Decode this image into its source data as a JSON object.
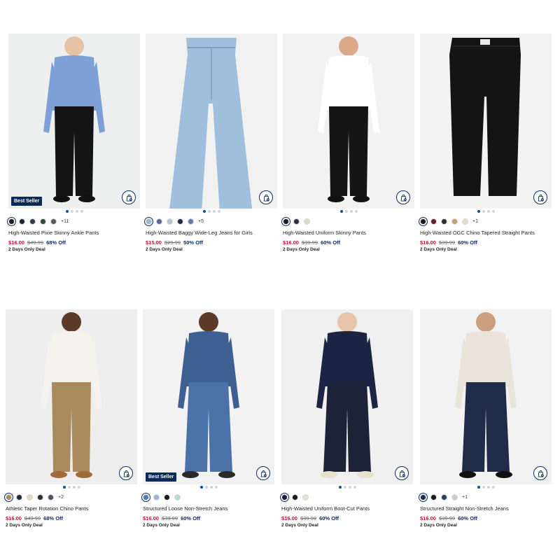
{
  "products": [
    {
      "name": "High-Waisted Pixie Skinny Ankle Pants",
      "sale_price": "$16.00",
      "original_price": "$49.99",
      "discount": "68% Off",
      "deal": "2 Days Only Deal",
      "badge": "Best Seller",
      "swatches": [
        "#1c1c1c",
        "#1f2433",
        "#30394f",
        "#2f4a3a",
        "#5a5a52"
      ],
      "more_colors": "+11",
      "colors": {
        "bg": "#eef0ef",
        "top": "#7ea0d6",
        "pants": "#141414",
        "shoe": "#111111",
        "skin": "#e6c3a6"
      }
    },
    {
      "name": "High-Waisted Baggy Wide-Leg Jeans for Girls",
      "sale_price": "$15.00",
      "original_price": "$29.99",
      "discount": "50% Off",
      "deal": "2 Days Only Deal",
      "badge": "",
      "swatches": [
        "#9ab4d4",
        "#516a97",
        "#b3c4dc",
        "#1f2b45",
        "#5f7ba8"
      ],
      "more_colors": "+5",
      "colors": {
        "bg": "#f1f1f1",
        "pants": "#9fbfdc"
      }
    },
    {
      "name": "High-Waisted Uniform Skinny Pants",
      "sale_price": "$16.00",
      "original_price": "$39.99",
      "discount": "60% Off",
      "deal": "2 Days Only Deal",
      "badge": "",
      "swatches": [
        "#1a1a1a",
        "#2b3140",
        "#e3d9c6"
      ],
      "more_colors": "",
      "colors": {
        "bg": "#f2f2f2",
        "top": "#ffffff",
        "pants": "#151515",
        "shoe": "#111111",
        "skin": "#d9a98a"
      }
    },
    {
      "name": "High-Waisted OGC Chino Tapered Straight Pants",
      "sale_price": "$16.00",
      "original_price": "$39.99",
      "discount": "60% Off",
      "deal": "2 Days Only Deal",
      "badge": "",
      "swatches": [
        "#1a1a1a",
        "#6b1f24",
        "#2b2f3a",
        "#c2a26e",
        "#e7dcc4"
      ],
      "more_colors": "+1",
      "colors": {
        "bg": "#f3f3f3",
        "pants": "#141414"
      }
    },
    {
      "name": "Athletic Taper Rotation Chino Pants",
      "sale_price": "$16.00",
      "original_price": "$49.99",
      "discount": "68% Off",
      "deal": "2 Days Only Deal",
      "badge": "",
      "swatches": [
        "#a88d5f",
        "#1f2a44",
        "#e3d8c1",
        "#2b2e33",
        "#4c5460"
      ],
      "more_colors": "+2",
      "colors": {
        "bg": "#eeeeee",
        "top": "#f4f2ec",
        "pants": "#a88a5c",
        "shoe": "#a06a3b",
        "skin": "#5b3a27"
      }
    },
    {
      "name": "Structured Loose Non-Stretch Jeans",
      "sale_price": "$16.00",
      "original_price": "$39.99",
      "discount": "60% Off",
      "deal": "2 Days Only Deal",
      "badge": "Best Seller",
      "swatches": [
        "#4f79b3",
        "#9fb6d3",
        "#1a1a1a",
        "#b9d8cf"
      ],
      "more_colors": "",
      "colors": {
        "bg": "#f2f2f2",
        "top": "#3e5f91",
        "pants": "#4a72a8",
        "shoe": "#2a2a2a",
        "skin": "#5b3a27"
      }
    },
    {
      "name": "High-Waisted Uniform Boot-Cut Pants",
      "sale_price": "$16.00",
      "original_price": "$39.99",
      "discount": "60% Off",
      "deal": "2 Days Only Deal",
      "badge": "",
      "swatches": [
        "#1c2236",
        "#1a1a1a",
        "#e6e1d5"
      ],
      "more_colors": "",
      "colors": {
        "bg": "#f0f0f0",
        "top": "#1b2442",
        "pants": "#1c2336",
        "shoe": "#e9e1cf",
        "skin": "#e7c4aa"
      }
    },
    {
      "name": "Structured Straight Non-Stretch Jeans",
      "sale_price": "$16.00",
      "original_price": "$39.99",
      "discount": "60% Off",
      "deal": "2 Days Only Deal",
      "badge": "",
      "swatches": [
        "#1f2d4d",
        "#1a1a1a",
        "#2c3f63",
        "#c9cdd2"
      ],
      "more_colors": "+1",
      "colors": {
        "bg": "#f2f2f2",
        "top": "#e9e4da",
        "pants": "#1f2b47",
        "shoe": "#111111",
        "skin": "#caa080"
      }
    }
  ]
}
